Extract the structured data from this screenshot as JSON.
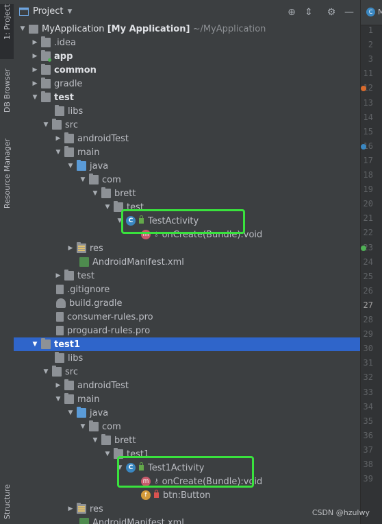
{
  "tool_window": {
    "title": "Project",
    "dropdown": "chevron-down-icon",
    "buttons": [
      "locate-icon",
      "collapse-all-icon",
      "settings-icon",
      "hide-icon"
    ]
  },
  "side_tabs": [
    {
      "label": "1: Project",
      "active": true
    },
    {
      "label": "DB Browser",
      "active": false
    },
    {
      "label": "Resource Manager",
      "active": false
    },
    {
      "label": "Structure",
      "active": false
    }
  ],
  "root": {
    "name": "MyApplication",
    "bracket": "[My Application]",
    "path": "~/MyApplication"
  },
  "tree": {
    "idea": ".idea",
    "app": "app",
    "common": "common",
    "gradle": "gradle",
    "test": "test",
    "test_libs": "libs",
    "test_src": "src",
    "test_androidTest": "androidTest",
    "test_main": "main",
    "test_java": "java",
    "test_com": "com",
    "test_brett": "brett",
    "test_pkg": "test",
    "test_activity": "TestActivity",
    "test_oncreate": "onCreate(Bundle):void",
    "test_res": "res",
    "test_manifest": "AndroidManifest.xml",
    "test_test": "test",
    "gitignore": ".gitignore",
    "build_gradle": "build.gradle",
    "consumer_rules": "consumer-rules.pro",
    "proguard_rules": "proguard-rules.pro",
    "test1": "test1",
    "test1_libs": "libs",
    "test1_src": "src",
    "test1_androidTest": "androidTest",
    "test1_main": "main",
    "test1_java": "java",
    "test1_com": "com",
    "test1_brett": "brett",
    "test1_pkg": "test1",
    "test1_activity": "Test1Activity",
    "test1_oncreate": "onCreate(Bundle):void",
    "test1_btn": "btn:Button",
    "test1_res": "res",
    "test1_manifest": "AndroidManifest.xml"
  },
  "gutter": {
    "tab_letter": "M",
    "lines": [
      "1",
      "2",
      "3",
      "11",
      "12",
      "13",
      "14",
      "15",
      "16",
      "17",
      "18",
      "19",
      "20",
      "21",
      "22",
      "23",
      "24",
      "25",
      "26",
      "27",
      "28",
      "29",
      "30",
      "31",
      "32",
      "33",
      "34",
      "35",
      "36",
      "37",
      "38",
      "39"
    ],
    "current_line": "27"
  },
  "watermark": "CSDN @hzulwy",
  "colors": {
    "selection": "#2f65ca",
    "highlight_box": "#39e23d",
    "background": "#3c3f41"
  }
}
